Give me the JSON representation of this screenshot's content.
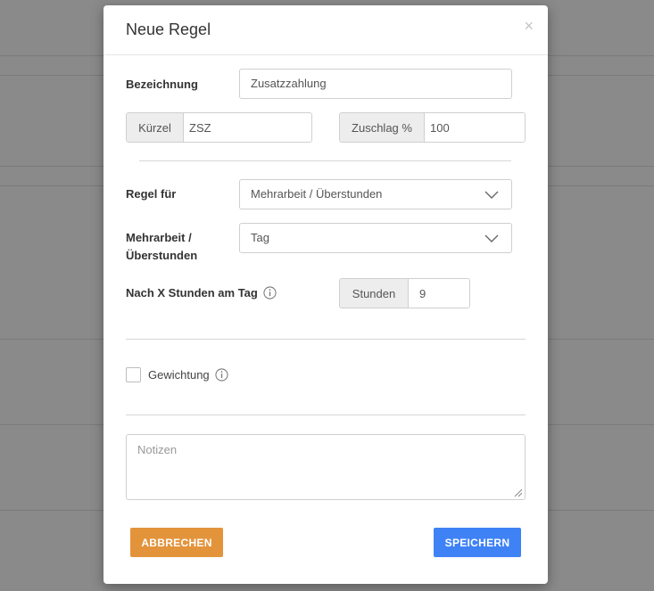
{
  "modal": {
    "title": "Neue Regel",
    "close_icon": "close-icon"
  },
  "form": {
    "bezeichnung": {
      "label": "Bezeichnung",
      "value": "Zusatzzahlung"
    },
    "kuerzel": {
      "addon": "Kürzel",
      "value": "ZSZ"
    },
    "zuschlag": {
      "addon": "Zuschlag %",
      "value": "100"
    },
    "regel_fuer": {
      "label": "Regel für",
      "selected": "Mehrarbeit / Überstunden"
    },
    "mehrarbeit": {
      "label_line1": "Mehrarbeit /",
      "label_line2": "Überstunden",
      "selected": "Tag"
    },
    "nach_x_stunden": {
      "label": "Nach X Stunden am Tag",
      "addon": "Stunden",
      "value": "9",
      "icon": "info-icon"
    },
    "gewichtung": {
      "label": "Gewichtung",
      "checked": false,
      "icon": "info-icon"
    },
    "notizen": {
      "placeholder": "Notizen"
    }
  },
  "buttons": {
    "cancel": "ABBRECHEN",
    "save": "SPEICHERN"
  },
  "colors": {
    "cancel_button": "#e3943b",
    "save_button": "#3f82f6",
    "backdrop": "#8a8a8a"
  }
}
